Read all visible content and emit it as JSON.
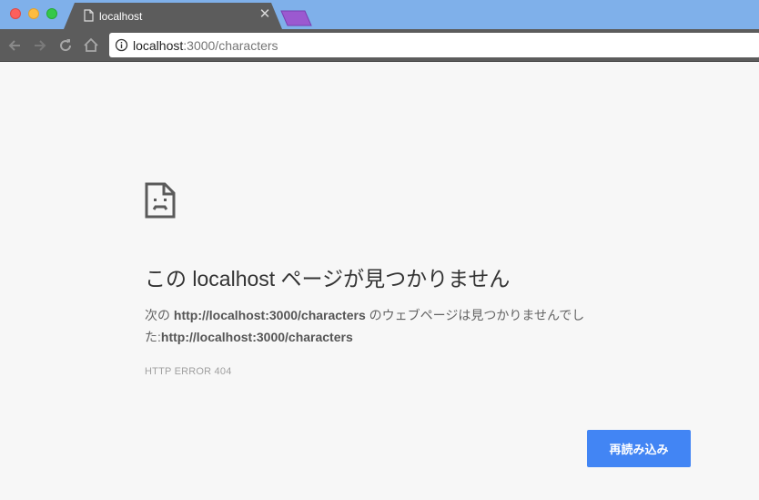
{
  "window": {
    "traffic_colors": {
      "close": "#fc605c",
      "minimize": "#fdbc40",
      "zoom": "#34c84a"
    },
    "tabstrip_color": "#7fb0ea"
  },
  "tab": {
    "title": "localhost",
    "icon": "file-icon",
    "close_icon": "close-icon"
  },
  "toolbar": {
    "back_icon": "arrow-left-icon",
    "forward_icon": "arrow-right-icon",
    "reload_icon": "reload-icon",
    "home_icon": "home-icon",
    "security_icon": "info-icon",
    "url_host": "localhost",
    "url_rest": ":3000/characters"
  },
  "error": {
    "icon": "sad-page-icon",
    "heading": "この localhost ページが見つかりません",
    "desc_prefix": "次の ",
    "desc_url_1": "http://localhost:3000/characters",
    "desc_mid": " のウェブページは見つかりませんでした:",
    "desc_url_2": "http://localhost:3000/characters",
    "code": "HTTP ERROR 404",
    "reload_label": "再読み込み",
    "accent_color": "#4285f4"
  }
}
